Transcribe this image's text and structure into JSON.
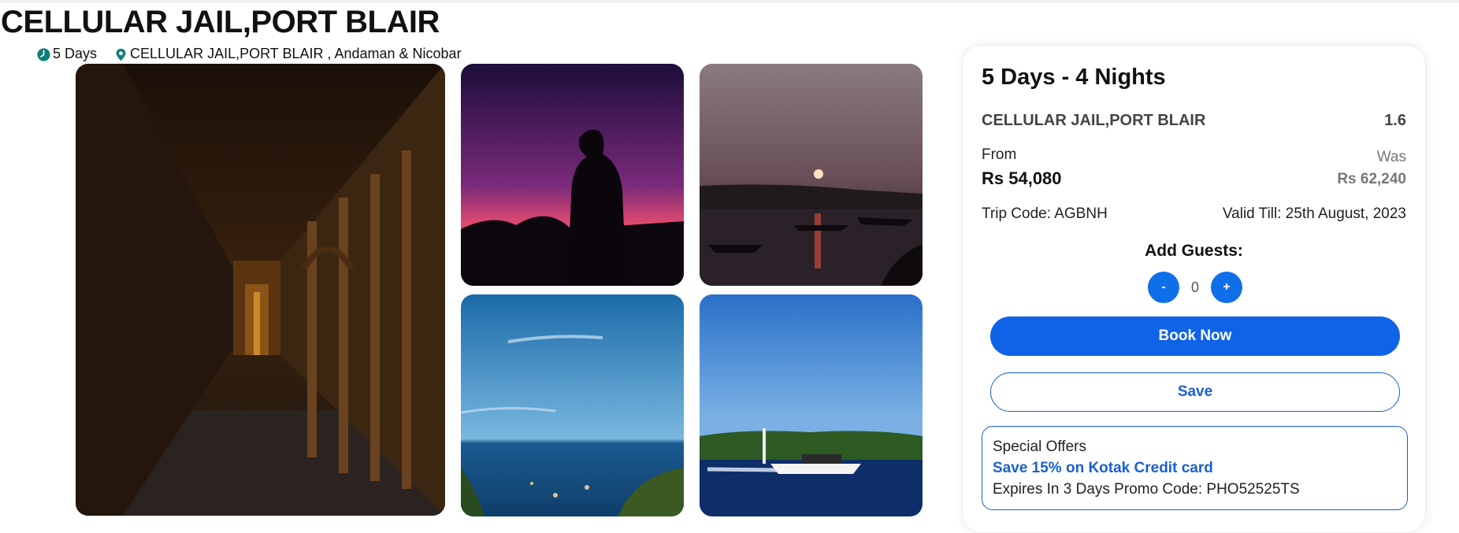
{
  "header": {
    "title": "CELLULAR JAIL,PORT BLAIR",
    "duration": "5 Days",
    "location": "CELLULAR JAIL,PORT BLAIR , Andaman & Nicobar"
  },
  "gallery": {
    "images": [
      "corridor-arches-photo",
      "silhouette-sunset-photo",
      "sunset-harbor-photo",
      "beach-sea-photo",
      "speedboat-photo"
    ]
  },
  "booking": {
    "title": "5 Days - 4 Nights",
    "destination": "CELLULAR JAIL,PORT BLAIR",
    "rating": "1.6",
    "from_label": "From",
    "price": "Rs 54,080",
    "was_label": "Was",
    "was_price": "Rs 62,240",
    "trip_code": "Trip Code: AGBNH",
    "valid_till": "Valid Till: 25th August, 2023",
    "guests_label": "Add Guests:",
    "minus": "-",
    "guests_value": "0",
    "plus": "+",
    "book_label": "Book Now",
    "save_label": "Save"
  },
  "offer": {
    "heading": "Special Offers",
    "title": "Save 15% on Kotak Credit card",
    "detail": "Expires In 3 Days Promo Code: PHO52525TS"
  },
  "colors": {
    "accent": "#0f63e6",
    "icon_teal": "#0f7f7a"
  }
}
